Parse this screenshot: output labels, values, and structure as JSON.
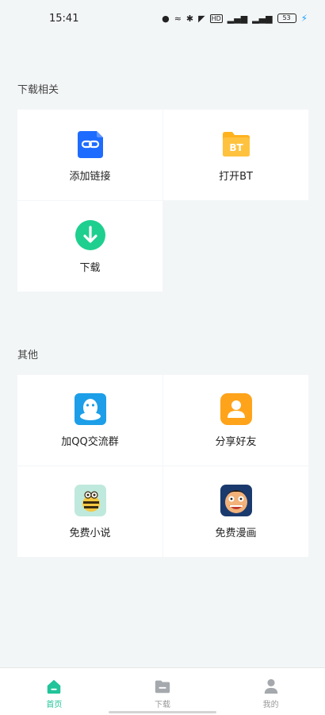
{
  "status_bar": {
    "time": "15:41",
    "net_badge": "HD",
    "signal1": "5G",
    "signal2": "5G",
    "battery": "53"
  },
  "sections": [
    {
      "title": "下载相关",
      "items": [
        {
          "label": "添加链接",
          "icon": "link-icon",
          "color": "#1e6bff"
        },
        {
          "label": "打开BT",
          "icon": "bt-folder-icon",
          "color": "#ffb21e"
        },
        {
          "label": "下载",
          "icon": "download-icon",
          "color": "#1fcf8f"
        }
      ]
    },
    {
      "title": "其他",
      "items": [
        {
          "label": "加QQ交流群",
          "icon": "qq-icon",
          "color": "#1d9ee8"
        },
        {
          "label": "分享好友",
          "icon": "user-share-icon",
          "color": "#ffa31a"
        },
        {
          "label": "免费小说",
          "icon": "novel-bee-icon",
          "color": "#bfe9dc"
        },
        {
          "label": "免费漫画",
          "icon": "comic-face-icon",
          "color": "#1a3a6e"
        }
      ]
    }
  ],
  "bottom_nav": [
    {
      "label": "首页",
      "icon": "home-icon",
      "active": true
    },
    {
      "label": "下载",
      "icon": "folder-icon",
      "active": false
    },
    {
      "label": "我的",
      "icon": "person-icon",
      "active": false
    }
  ]
}
